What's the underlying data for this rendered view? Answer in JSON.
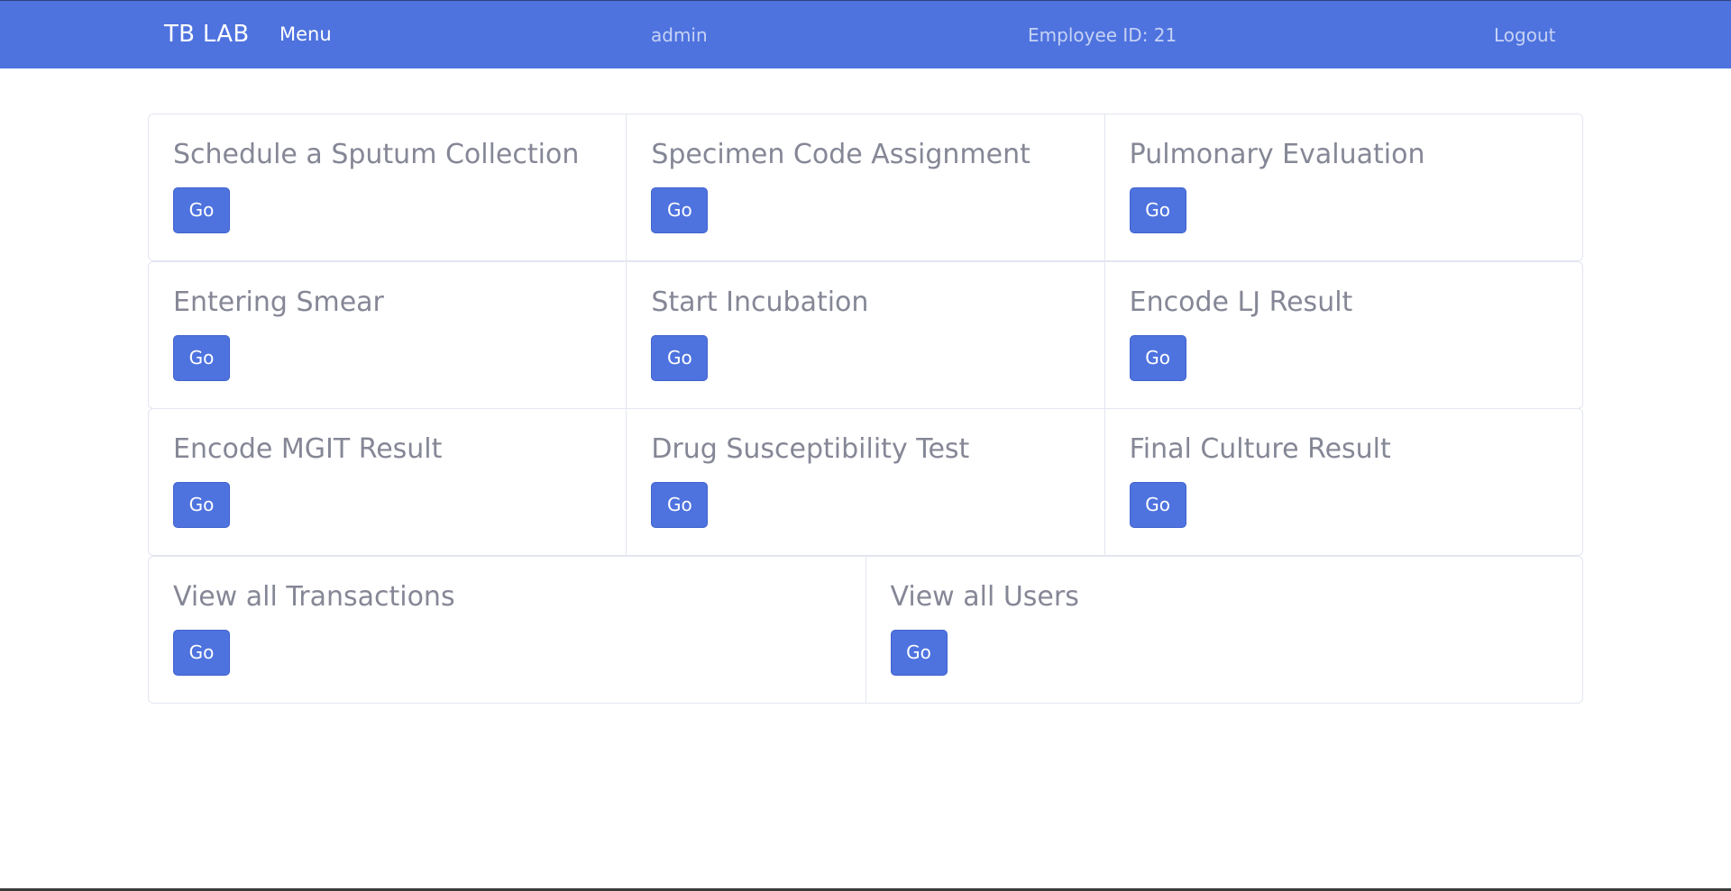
{
  "navbar": {
    "brand": "TB LAB",
    "menu": "Menu",
    "user": "admin",
    "employee": "Employee ID: 21",
    "logout": "Logout"
  },
  "cards": [
    {
      "title": "Schedule a Sputum Collection",
      "button": "Go"
    },
    {
      "title": "Specimen Code Assignment",
      "button": "Go"
    },
    {
      "title": "Pulmonary Evaluation",
      "button": "Go"
    },
    {
      "title": "Entering Smear",
      "button": "Go"
    },
    {
      "title": "Start Incubation",
      "button": "Go"
    },
    {
      "title": "Encode LJ Result",
      "button": "Go"
    },
    {
      "title": "Encode MGIT Result",
      "button": "Go"
    },
    {
      "title": "Drug Susceptibility Test",
      "button": "Go"
    },
    {
      "title": "Final Culture Result",
      "button": "Go"
    },
    {
      "title": "View all Transactions",
      "button": "Go"
    },
    {
      "title": "View all Users",
      "button": "Go"
    }
  ],
  "colors": {
    "primary": "#4e73df",
    "text_muted": "#858796",
    "border": "#e3e6f0"
  }
}
